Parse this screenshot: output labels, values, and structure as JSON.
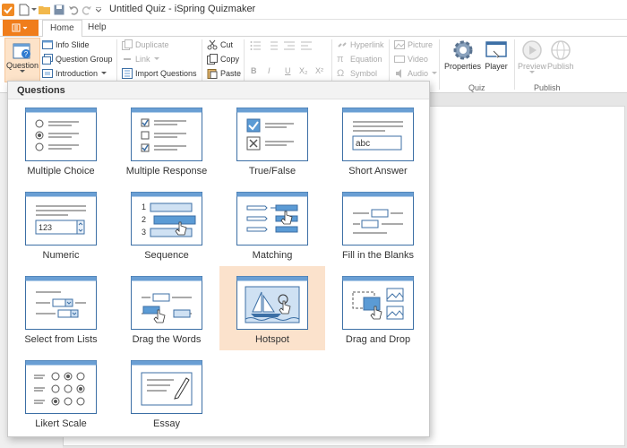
{
  "window": {
    "title": "Untitled Quiz - iSpring Quizmaker"
  },
  "tabs": {
    "home": "Home",
    "help": "Help"
  },
  "ribbon": {
    "question_label": "Question",
    "info_slide": "Info Slide",
    "question_group": "Question Group",
    "introduction": "Introduction",
    "duplicate": "Duplicate",
    "link": "Link",
    "import_questions": "Import Questions",
    "cut": "Cut",
    "copy": "Copy",
    "paste": "Paste",
    "hyperlink": "Hyperlink",
    "equation": "Equation",
    "symbol": "Symbol",
    "picture": "Picture",
    "video": "Video",
    "audio": "Audio",
    "properties": "Properties",
    "player": "Player",
    "preview": "Preview",
    "publish": "Publish",
    "group_quiz": "Quiz",
    "group_publish": "Publish",
    "fmt_b": "B",
    "fmt_i": "I",
    "fmt_u": "U",
    "fmt_sub": "X₂",
    "fmt_sup": "X²"
  },
  "dropdown": {
    "title": "Questions",
    "items": [
      {
        "label": "Multiple Choice"
      },
      {
        "label": "Multiple Response"
      },
      {
        "label": "True/False"
      },
      {
        "label": "Short Answer"
      },
      {
        "label": "Numeric"
      },
      {
        "label": "Sequence"
      },
      {
        "label": "Matching"
      },
      {
        "label": "Fill in the Blanks"
      },
      {
        "label": "Select from Lists"
      },
      {
        "label": "Drag the Words"
      },
      {
        "label": "Hotspot"
      },
      {
        "label": "Drag and Drop"
      },
      {
        "label": "Likert Scale"
      },
      {
        "label": "Essay"
      }
    ],
    "highlighted": "Hotspot",
    "numeric_sample": "123",
    "short_answer_sample": "abc",
    "sequence_numbers": [
      "1",
      "2",
      "3"
    ]
  },
  "colors": {
    "accent": "#f07d1b",
    "highlight": "#fbe2cc",
    "thumb_header": "#6a9fd4",
    "thumb_border": "#3c6fa5"
  }
}
